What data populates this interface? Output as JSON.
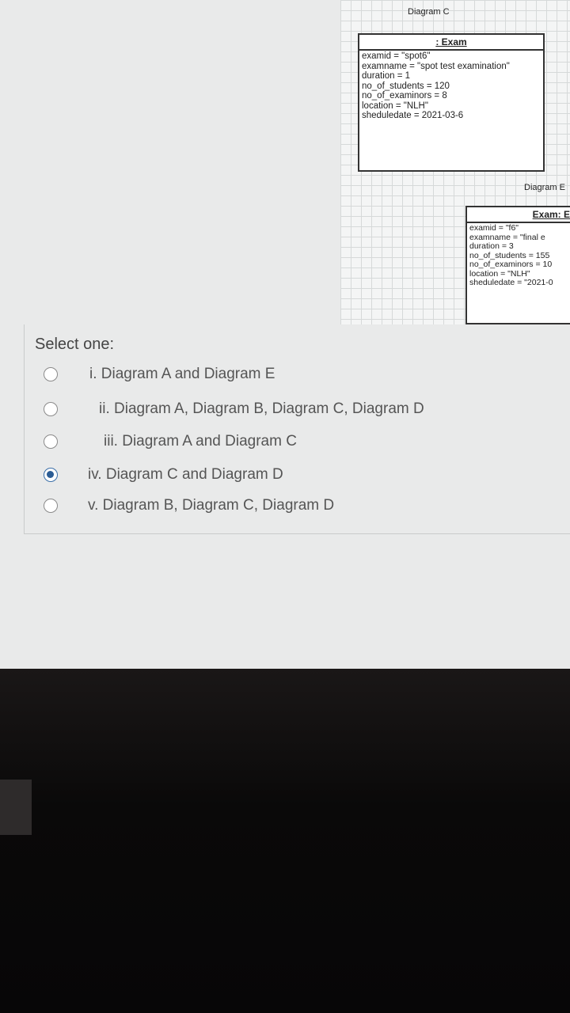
{
  "diagram_c": {
    "label": "Diagram C",
    "title": ": Exam",
    "attrs": [
      "examid = \"spot6\"",
      "examname = \"spot test examination\"",
      "duration = 1",
      "no_of_students = 120",
      "no_of_examinors = 8",
      "location = \"NLH\"",
      "sheduledate = 2021-03-6"
    ]
  },
  "diagram_e": {
    "label": "Diagram E",
    "title": "Exam: E",
    "attrs": [
      "examid = \"f6\"",
      "examname = \"final e",
      "duration = 3",
      "no_of_students = 155",
      "no_of_examinors = 10",
      "location = \"NLH\"",
      "sheduledate = \"2021-0"
    ]
  },
  "quiz": {
    "prompt": "Select one:",
    "options": [
      {
        "label": "i. Diagram A and Diagram E",
        "selected": false
      },
      {
        "label": "ii. Diagram A, Diagram B, Diagram C, Diagram D",
        "selected": false
      },
      {
        "label": "iii. Diagram A and Diagram C",
        "selected": false
      },
      {
        "label": "iv. Diagram C and Diagram D",
        "selected": true
      },
      {
        "label": "v. Diagram B, Diagram C, Diagram D",
        "selected": false
      }
    ]
  }
}
